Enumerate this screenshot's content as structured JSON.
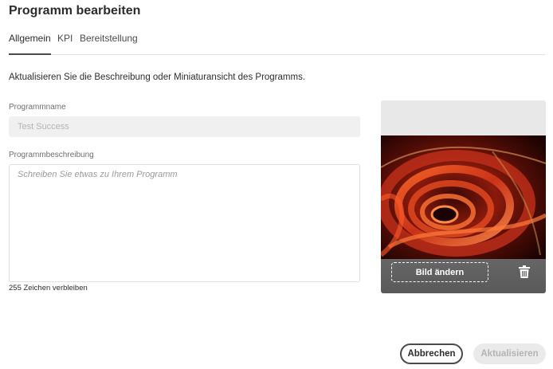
{
  "dialog": {
    "title": "Programm bearbeiten"
  },
  "tabs": [
    {
      "label": "Allgemein",
      "active": true
    },
    {
      "label": "KPI",
      "active": false
    },
    {
      "label": "Bereitstellung",
      "active": false
    }
  ],
  "intro": "Aktualisieren Sie die Beschreibung oder Miniaturansicht des Programms.",
  "form": {
    "name_label": "Programmname",
    "name_placeholder": "Test Success",
    "name_value": "",
    "description_label": "Programmbeschreibung",
    "description_placeholder": "Schreiben Sie etwas zu Ihrem Programm",
    "description_value": "",
    "chars_remaining": "255 Zeichen verbleiben"
  },
  "thumbnail": {
    "change_label": "Bild ändern",
    "delete_icon": "trash-icon"
  },
  "buttons": {
    "cancel_label": "Abbrechen",
    "update_label": "Aktualisieren",
    "update_disabled": true
  },
  "colors": {
    "primary_text": "#2c2c2c",
    "field_bg": "#f0f0f0",
    "disabled_button_bg": "#eaeaea",
    "image_overlay": "#5e5e5e"
  }
}
